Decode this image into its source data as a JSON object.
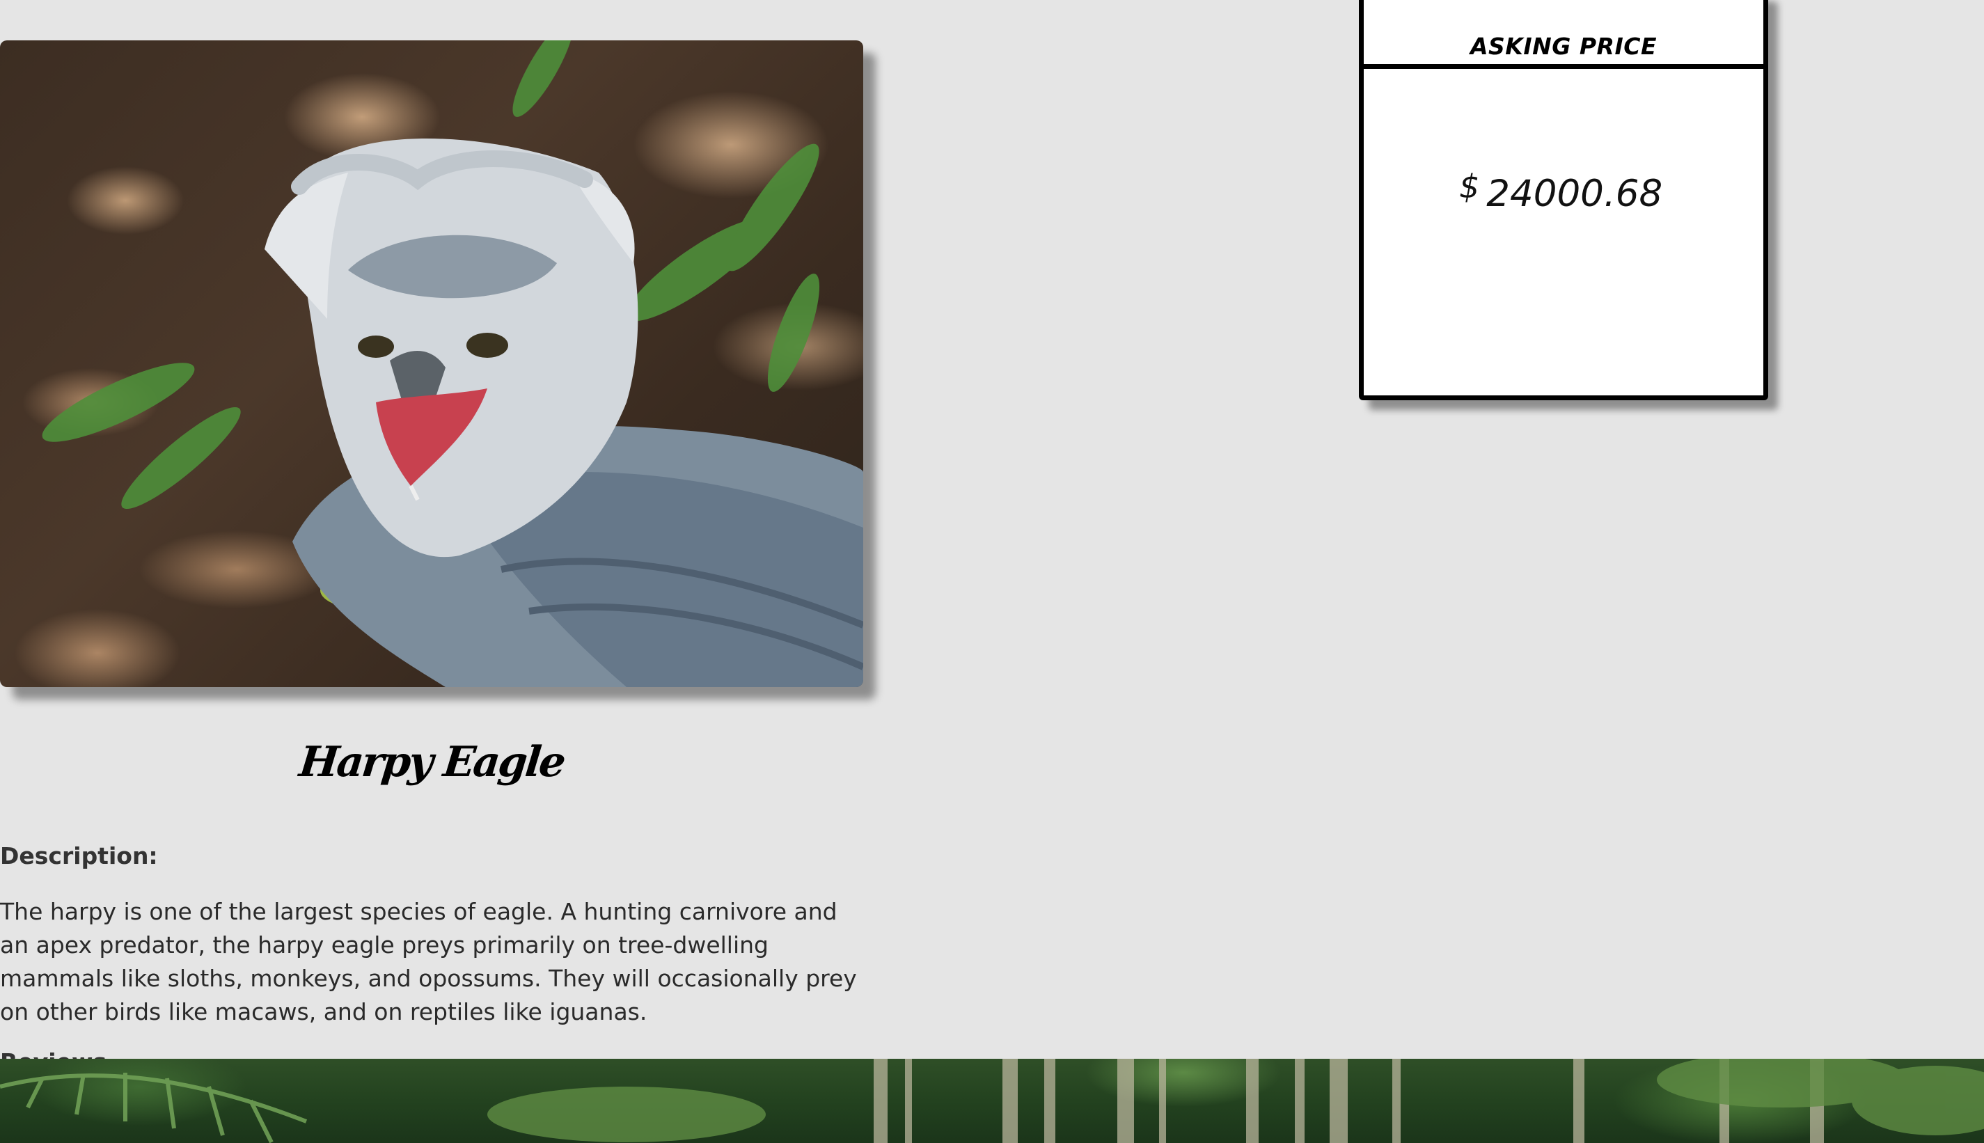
{
  "product": {
    "name": "Harpy Eagle",
    "image_alt": "Harpy Eagle",
    "description_heading": "Description:",
    "description": "The harpy is one of the largest species of eagle. A hunting carnivore and an apex predator, the harpy eagle preys primarily on tree-dwelling mammals like sloths, monkeys, and opossums. They will occasionally prey on other birds like macaws, and on reptiles like iguanas.",
    "reviews_heading": "Reviews"
  },
  "pricing": {
    "label": "ASKING PRICE",
    "currency": "$",
    "amount": "24000.68"
  }
}
